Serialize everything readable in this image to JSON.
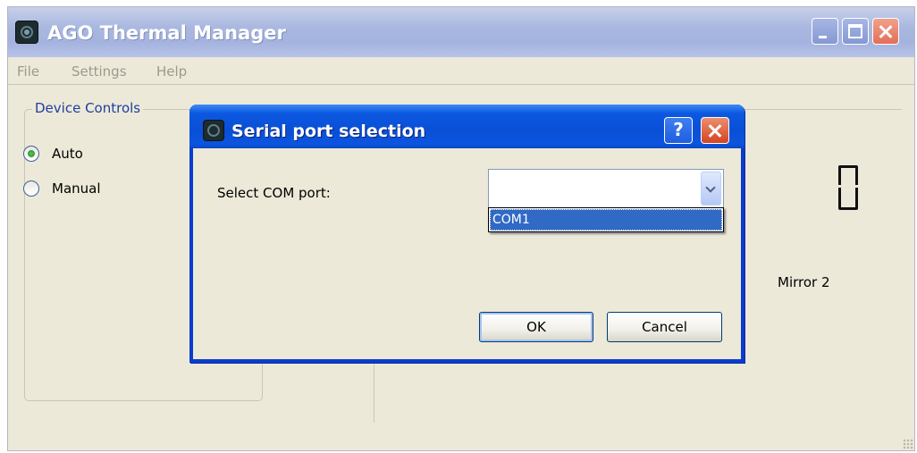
{
  "main_window": {
    "title": "AGO Thermal Manager",
    "menu": [
      "File",
      "Settings",
      "Help"
    ],
    "device_controls": {
      "legend": "Device Controls",
      "options": [
        {
          "label": "Auto",
          "checked": true
        },
        {
          "label": "Manual",
          "checked": false
        }
      ]
    },
    "mirror_label": "Mirror 2",
    "digit_display": "0"
  },
  "dialog": {
    "title": "Serial port selection",
    "help_label": "?",
    "com_label": "Select COM port:",
    "combo_value": "",
    "dropdown_options": [
      "COM1"
    ],
    "ok_label": "OK",
    "cancel_label": "Cancel"
  },
  "icons": {
    "app": "app-logo-icon",
    "minimize": "minimize-icon",
    "maximize": "maximize-icon",
    "close": "close-icon",
    "dropdown": "chevron-down-icon",
    "help": "help-icon"
  },
  "colors": {
    "dialog_title": "#0a4fd6",
    "selection": "#316ac5",
    "group_legend": "#1e3fa0",
    "window_bg": "#ece9d8"
  }
}
